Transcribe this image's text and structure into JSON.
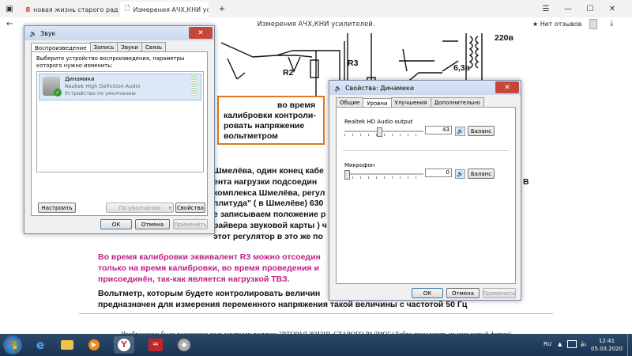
{
  "browser": {
    "tabs": [
      {
        "label": "новая жизнь старого радио",
        "icon": "yandex-icon"
      },
      {
        "label": "Измерения АЧХ,КНИ ус",
        "icon": "document-icon"
      }
    ],
    "new_tab": "+",
    "window_controls": [
      "—",
      "☐",
      "✕"
    ],
    "page_title": "Измерения АЧХ,КНИ усилителей.",
    "feedback": "★ Нет отзывов"
  },
  "page": {
    "schematic_labels": {
      "r2": "R2",
      "r3": "R3",
      "v220": "220в",
      "v63": "6,3в"
    },
    "callout": [
      "во время",
      "калибровки контроли-",
      "ровать напряжение",
      "вольтметром"
    ],
    "para1": [
      "Шмелёва, один конец кабе",
      "ента нагрузки подсоедин",
      "комплекса Шмелёва, регул",
      "плитуда\" ( в Шмелёве) 630",
      "е записываем положение р",
      "райвера звуковой карты ) ч",
      "этот регулятор в это же по"
    ],
    "para1_right": "В",
    "para2": [
      "Во время калибровки эквивалент R3 можно отсоедин",
      "только на время калибровки, во время проведения и",
      "присоединён, так-как является нагрузкой ТВЗ."
    ],
    "para3": [
      "Вольтметр, которым будете контролировать величин",
      "предназначен для измерения переменного напряжения такой величины с частотой 50 Гц"
    ],
    "footer": "Изображение было размещено пользователем ресурса: \"ВТОРАЯ ЖИЗНЬ СТАРОГО РАДИО\" (Добро пожаловать на наш новый форум)"
  },
  "sound_dialog": {
    "title": "Звук",
    "tabs": [
      "Воспроизведение",
      "Запись",
      "Звуки",
      "Связь"
    ],
    "prompt": "Выберите устройство воспроизведения, параметры которого нужно изменить:",
    "device": {
      "name": "Динамики",
      "driver": "Realtek High Definition Audio",
      "status": "Устройство по умолчанию"
    },
    "configure": "Настроить",
    "default_select": "По умолчанию",
    "properties": "Свойства",
    "ok": "ОК",
    "cancel": "Отмена",
    "apply": "Применить"
  },
  "props_dialog": {
    "title": "Свойства: Динамики",
    "tabs": [
      "Общие",
      "Уровни",
      "Улучшения",
      "Дополнительно"
    ],
    "output": {
      "label": "Realtek HD Audio output",
      "value": "43",
      "level": 0.43,
      "balance": "Баланс"
    },
    "mic": {
      "label": "Микрофон",
      "value": "0",
      "level": 0.0,
      "balance": "Баланс"
    },
    "ok": "ОК",
    "cancel": "Отмена",
    "apply": "Применить"
  },
  "taskbar": {
    "lang": "RU",
    "time": "12:41",
    "date": "05.03.2020"
  },
  "colors": {
    "callout_border": "#e07a1a",
    "magenta": "#c0208c",
    "taskbar": "#1f3b5c"
  }
}
